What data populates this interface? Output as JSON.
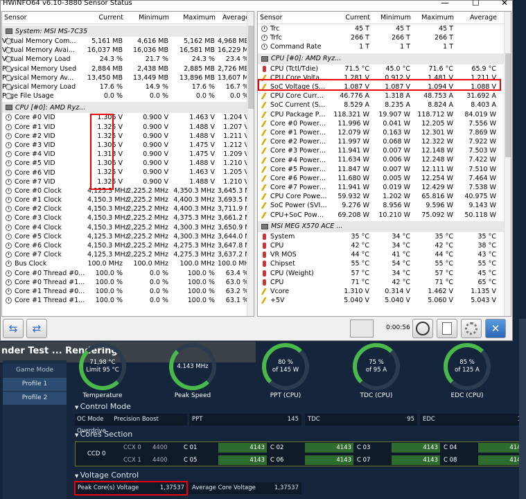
{
  "window": {
    "title": "HWiNFO64 v6.10-3880 Sensor Status",
    "min": "—",
    "max": "☐",
    "close": "✕"
  },
  "headers": {
    "sensor": "Sensor",
    "current": "Current",
    "minimum": "Minimum",
    "maximum": "Maximum",
    "average": "Average"
  },
  "left": {
    "g1": "System: MSI MS-7C35",
    "rows1": [
      [
        "Virtual Memory Com...",
        "5,161 MB",
        "4,616 MB",
        "5,162 MB",
        "4,968 MB"
      ],
      [
        "Virtual Memory Avai...",
        "16,037 MB",
        "16,036 MB",
        "16,581 MB",
        "16,229 MB"
      ],
      [
        "Virtual Memory Load",
        "24.3 %",
        "21.7 %",
        "24.3 %",
        "23.4 %"
      ],
      [
        "Physical Memory Used",
        "2,884 MB",
        "2,438 MB",
        "2,885 MB",
        "2,726 MB"
      ],
      [
        "Physical Memory Av...",
        "13,450 MB",
        "13,449 MB",
        "13,896 MB",
        "13,607 MB"
      ],
      [
        "Physical Memory Load",
        "17.6 %",
        "14.9 %",
        "17.6 %",
        "16.7 %"
      ],
      [
        "Page File Usage",
        "0.0 %",
        "0.0 %",
        "0.0 %",
        "0.0 %"
      ]
    ],
    "g2": "CPU [#0]: AMD Ryz...",
    "rows2": [
      [
        "Core #0 VID",
        "1.306 V",
        "0.900 V",
        "1.463 V",
        "1.204 V"
      ],
      [
        "Core #1 VID",
        "1.325 V",
        "0.900 V",
        "1.488 V",
        "1.207 V"
      ],
      [
        "Core #2 VID",
        "1.325 V",
        "0.900 V",
        "1.488 V",
        "1.211 V"
      ],
      [
        "Core #3 VID",
        "1.306 V",
        "0.900 V",
        "1.475 V",
        "1.212 V"
      ],
      [
        "Core #4 VID",
        "1.313 V",
        "0.900 V",
        "1.475 V",
        "1.209 V"
      ],
      [
        "Core #5 VID",
        "1.306 V",
        "0.900 V",
        "1.488 V",
        "1.210 V"
      ],
      [
        "Core #6 VID",
        "1.325 V",
        "0.900 V",
        "1.463 V",
        "1.205 V"
      ],
      [
        "Core #7 VID",
        "1.325 V",
        "0.900 V",
        "1.488 V",
        "1.210 V"
      ],
      [
        "Core #0 Clock",
        "4,125.3 MHz",
        "2,225.2 MHz",
        "4,350.3 MHz",
        "3,645.3 MHz"
      ],
      [
        "Core #1 Clock",
        "4,150.3 MHz",
        "2,225.2 MHz",
        "4,400.3 MHz",
        "3,693.5 MHz"
      ],
      [
        "Core #2 Clock",
        "4,150.3 MHz",
        "2,225.2 MHz",
        "4,400.3 MHz",
        "3,711.9 MHz"
      ],
      [
        "Core #3 Clock",
        "4,150.3 MHz",
        "2,225.2 MHz",
        "4,375.3 MHz",
        "3,661.2 MHz"
      ],
      [
        "Core #4 Clock",
        "4,150.3 MHz",
        "2,225.2 MHz",
        "4,300.3 MHz",
        "3,650.9 MHz"
      ],
      [
        "Core #5 Clock",
        "4,125.3 MHz",
        "2,225.2 MHz",
        "4,300.3 MHz",
        "3,644.0 MHz"
      ],
      [
        "Core #6 Clock",
        "4,150.3 MHz",
        "2,225.2 MHz",
        "4,275.3 MHz",
        "3,647.8 MHz"
      ],
      [
        "Core #7 Clock",
        "4,125.3 MHz",
        "2,225.2 MHz",
        "4,275.3 MHz",
        "3,637.2 MHz"
      ],
      [
        "Bus Clock",
        "100.0 MHz",
        "100.0 MHz",
        "100.0 MHz",
        "100.0 MHz"
      ],
      [
        "Core #0 Thread #0...",
        "100.0 %",
        "0.0 %",
        "100.0 %",
        "63.4 %"
      ],
      [
        "Core #0 Thread #1...",
        "100.0 %",
        "0.0 %",
        "100.0 %",
        "63.0 %"
      ],
      [
        "Core #1 Thread #0...",
        "100.0 %",
        "0.0 %",
        "100.0 %",
        "63.2 %"
      ],
      [
        "Core #1 Thread #1...",
        "100.0 %",
        "0.0 %",
        "100.0 %",
        "63.1 %"
      ]
    ]
  },
  "right": {
    "rows0": [
      [
        "Trc",
        "45 T",
        "45 T",
        "45 T",
        ""
      ],
      [
        "Trfc",
        "266 T",
        "266 T",
        "266 T",
        ""
      ],
      [
        "Command Rate",
        "1 T",
        "1 T",
        "1 T",
        ""
      ]
    ],
    "g1": "CPU [#0]: AMD Ryz...",
    "rows1": [
      [
        "therm",
        "CPU (Tctl/Tdie)",
        "71.5 °C",
        "45.0 °C",
        "71.6 °C",
        "65.9 °C"
      ],
      [
        "bolt",
        "CPU Core Voltage (...",
        "1.281 V",
        "0.912 V",
        "1.481 V",
        "1.211 V"
      ],
      [
        "bolt",
        "SoC Voltage (SVI2 ...",
        "1.087 V",
        "1.087 V",
        "1.094 V",
        "1.088 V"
      ],
      [
        "bolt",
        "CPU Core Current (...",
        "46.776 A",
        "1.318 A",
        "48.753 A",
        "31.692 A"
      ],
      [
        "bolt",
        "SoC Current (SVI2 ...",
        "8.529 A",
        "8.235 A",
        "8.824 A",
        "8.403 A"
      ],
      [
        "bolt",
        "CPU Package Powe...",
        "118.321 W",
        "19.907 W",
        "118.712 W",
        "84.019 W"
      ],
      [
        "bolt",
        "Core #0 Power (SMU)",
        "11.996 W",
        "0.041 W",
        "12.205 W",
        "7.556 W"
      ],
      [
        "bolt",
        "Core #1 Power (SMU)",
        "12.079 W",
        "0.163 W",
        "12.301 W",
        "7.869 W"
      ],
      [
        "bolt",
        "Core #2 Power (SMU)",
        "11.997 W",
        "0.068 W",
        "12.322 W",
        "7.922 W"
      ],
      [
        "bolt",
        "Core #3 Power (SMU)",
        "11.941 W",
        "0.007 W",
        "12.148 W",
        "7.503 W"
      ],
      [
        "bolt",
        "Core #4 Power (SMU)",
        "11.634 W",
        "0.006 W",
        "12.248 W",
        "7.422 W"
      ],
      [
        "bolt",
        "Core #5 Power (SMU)",
        "11.847 W",
        "0.007 W",
        "12.111 W",
        "7.510 W"
      ],
      [
        "bolt",
        "Core #6 Power (SMU)",
        "11.680 W",
        "0.005 W",
        "12.254 W",
        "7.464 W"
      ],
      [
        "bolt",
        "Core #7 Power (SMU)",
        "11.941 W",
        "0.019 W",
        "12.429 W",
        "7.538 W"
      ],
      [
        "bolt",
        "CPU Core Power (SV...",
        "59.932 W",
        "1.202 W",
        "65.816 W",
        "40.975 W"
      ],
      [
        "bolt",
        "SoC Power (SVI2 TFN)",
        "9.276 W",
        "8.956 W",
        "9.596 W",
        "9.143 W"
      ],
      [
        "bolt",
        "CPU+SoC Power (S...",
        "69.208 W",
        "10.210 W",
        "75.092 W",
        "50.118 W"
      ]
    ],
    "g2": "MSI MEG X570 ACE ...",
    "rows2": [
      [
        "therm",
        "System",
        "35 °C",
        "34 °C",
        "35 °C",
        "35 °C"
      ],
      [
        "therm",
        "CPU",
        "42 °C",
        "34 °C",
        "42 °C",
        "38 °C"
      ],
      [
        "therm",
        "VR MOS",
        "44 °C",
        "41 °C",
        "44 °C",
        "43 °C"
      ],
      [
        "therm",
        "Chipset",
        "55 °C",
        "54 °C",
        "55 °C",
        "55 °C"
      ],
      [
        "therm",
        "CPU (Weight)",
        "57 °C",
        "34 °C",
        "57 °C",
        "45 °C"
      ],
      [
        "therm",
        "CPU",
        "71 °C",
        "42 °C",
        "71 °C",
        "65 °C"
      ],
      [
        "bolt",
        "Vcore",
        "1.310 V",
        "0.314 V",
        "1.462 V",
        "1.135 V"
      ],
      [
        "bolt",
        "+5V",
        "5.040 V",
        "5.040 V",
        "5.060 V",
        "5.043 V"
      ]
    ]
  },
  "toolbar": {
    "arrows1": "⇆",
    "arrows2": "⇄",
    "timer": "0:00:56",
    "clock_icon": "clock-icon",
    "close_icon": "close-icon"
  },
  "amd": {
    "title": "nder Test ... Rendering",
    "nav": [
      "Game Mode",
      "Profile 1",
      "Profile 2"
    ],
    "gauges": [
      {
        "v": "71,98 °C",
        "s": "Limit 95 °C",
        "l": "Temperature"
      },
      {
        "v": "4.143  MHz",
        "s": "",
        "l": "Peak Speed"
      },
      {
        "v": "80 %",
        "s": "of 145 W",
        "l": "PPT (CPU)"
      },
      {
        "v": "75 %",
        "s": "of 95 A",
        "l": "TDC (CPU)"
      },
      {
        "v": "85 %",
        "s": "of 125 A",
        "l": "EDC (CPU)"
      }
    ],
    "control_mode": "Control Mode",
    "oc_mode": "OC Mode",
    "oc_val": "Precision Boost Overdrive",
    "ppt": "PPT",
    "ppt_v": "145",
    "tdc": "TDC",
    "tdc_v": "95",
    "edc": "EDC",
    "edc_v": "125",
    "cores_section": "Cores Section",
    "ccd": "CCD 0",
    "ccx0": "CCX 0",
    "ccx1": "CCX 1",
    "ccx_v": "4400",
    "cores": [
      [
        "C 01",
        "4143"
      ],
      [
        "C 02",
        "4143"
      ],
      [
        "C 03",
        "4143"
      ],
      [
        "C 04",
        "4143"
      ],
      [
        "C 05",
        "4143"
      ],
      [
        "C 06",
        "4143"
      ],
      [
        "C 07",
        "4143"
      ],
      [
        "C 08",
        "4143"
      ]
    ],
    "voltage_control": "Voltage Control",
    "peak_v_label": "Peak Core(s) Voltage",
    "peak_v": "1,37537",
    "avg_v_label": "Average Core Voltage",
    "avg_v": "1,37537"
  }
}
